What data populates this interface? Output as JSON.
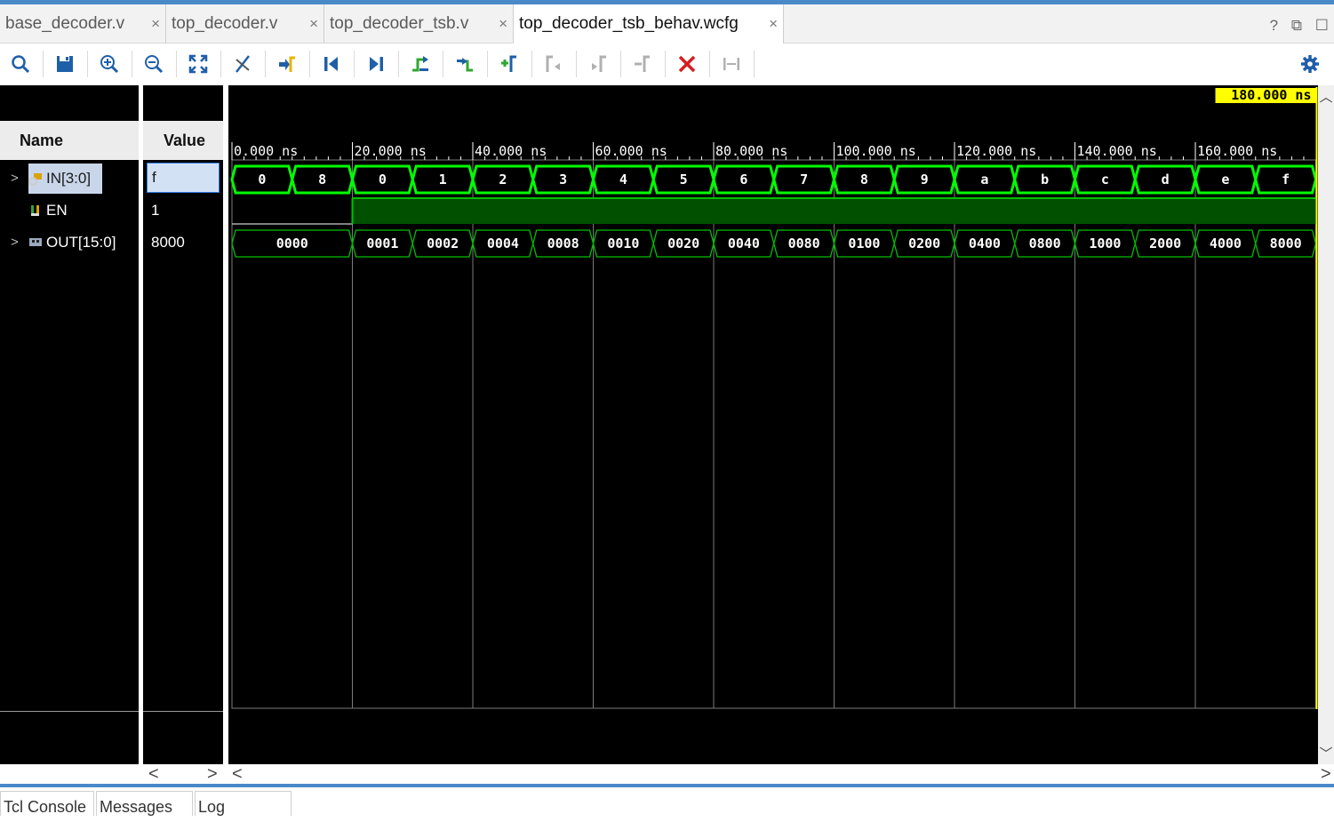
{
  "tabs": [
    {
      "label": "base_decoder.v",
      "close": "×",
      "active": false
    },
    {
      "label": "top_decoder.v",
      "close": "×",
      "active": false
    },
    {
      "label": "top_decoder_tsb.v",
      "close": "×",
      "active": false
    },
    {
      "label": "top_decoder_tsb_behav.wcfg",
      "close": "×",
      "active": true
    }
  ],
  "window_controls": {
    "help": "?",
    "restore": "⧉",
    "maximize": "☐"
  },
  "toolbar": {
    "icons": [
      "search-icon",
      "save-icon",
      "zoom-in-icon",
      "zoom-out-icon",
      "zoom-fit-icon",
      "cursor-snap-icon",
      "go-to-time-zero-icon",
      "go-to-start-icon",
      "go-to-end-icon",
      "previous-transition-icon",
      "next-transition-icon",
      "add-marker-icon",
      "previous-marker-icon",
      "next-marker-icon",
      "remove-marker-icon",
      "delete-icon",
      "marker-range-icon",
      "settings-gear-icon"
    ],
    "accent_green": "#2fa82f",
    "accent_yellow": "#e8b400",
    "accent_red": "#d61f1f"
  },
  "columns": {
    "name": "Name",
    "value": "Value"
  },
  "signals": [
    {
      "name": "IN[3:0]",
      "value": "f",
      "expandable": true,
      "selected": true,
      "icon": "bus-input-icon"
    },
    {
      "name": "EN",
      "value": "1",
      "expandable": false,
      "selected": false,
      "icon": "bit-input-icon"
    },
    {
      "name": "OUT[15:0]",
      "value": "8000",
      "expandable": true,
      "selected": false,
      "icon": "bus-output-icon"
    }
  ],
  "cursor": {
    "label": "180.000 ns",
    "time_ns": 180
  },
  "timeline": {
    "ticks": [
      "0.000 ns",
      "20.000 ns",
      "40.000 ns",
      "60.000 ns",
      "80.000 ns",
      "100.000 ns",
      "120.000 ns",
      "140.000 ns",
      "160.000 ns"
    ],
    "range_ns": [
      0,
      180
    ],
    "step_ns": 20
  },
  "waves": {
    "in": {
      "segments": [
        {
          "t0": 0,
          "t1": 10,
          "v": "0"
        },
        {
          "t0": 10,
          "t1": 20,
          "v": "8"
        },
        {
          "t0": 20,
          "t1": 30,
          "v": "0"
        },
        {
          "t0": 30,
          "t1": 40,
          "v": "1"
        },
        {
          "t0": 40,
          "t1": 50,
          "v": "2"
        },
        {
          "t0": 50,
          "t1": 60,
          "v": "3"
        },
        {
          "t0": 60,
          "t1": 70,
          "v": "4"
        },
        {
          "t0": 70,
          "t1": 80,
          "v": "5"
        },
        {
          "t0": 80,
          "t1": 90,
          "v": "6"
        },
        {
          "t0": 90,
          "t1": 100,
          "v": "7"
        },
        {
          "t0": 100,
          "t1": 110,
          "v": "8"
        },
        {
          "t0": 110,
          "t1": 120,
          "v": "9"
        },
        {
          "t0": 120,
          "t1": 130,
          "v": "a"
        },
        {
          "t0": 130,
          "t1": 140,
          "v": "b"
        },
        {
          "t0": 140,
          "t1": 150,
          "v": "c"
        },
        {
          "t0": 150,
          "t1": 160,
          "v": "d"
        },
        {
          "t0": 160,
          "t1": 170,
          "v": "e"
        },
        {
          "t0": 170,
          "t1": 180,
          "v": "f"
        }
      ]
    },
    "en": {
      "high_from_ns": 20,
      "high_to_ns": 180
    },
    "out": {
      "segments": [
        {
          "t0": 0,
          "t1": 20,
          "v": "0000"
        },
        {
          "t0": 20,
          "t1": 30,
          "v": "0001"
        },
        {
          "t0": 30,
          "t1": 40,
          "v": "0002"
        },
        {
          "t0": 40,
          "t1": 50,
          "v": "0004"
        },
        {
          "t0": 50,
          "t1": 60,
          "v": "0008"
        },
        {
          "t0": 60,
          "t1": 70,
          "v": "0010"
        },
        {
          "t0": 70,
          "t1": 80,
          "v": "0020"
        },
        {
          "t0": 80,
          "t1": 90,
          "v": "0040"
        },
        {
          "t0": 90,
          "t1": 100,
          "v": "0080"
        },
        {
          "t0": 100,
          "t1": 110,
          "v": "0100"
        },
        {
          "t0": 110,
          "t1": 120,
          "v": "0200"
        },
        {
          "t0": 120,
          "t1": 130,
          "v": "0400"
        },
        {
          "t0": 130,
          "t1": 140,
          "v": "0800"
        },
        {
          "t0": 140,
          "t1": 150,
          "v": "1000"
        },
        {
          "t0": 150,
          "t1": 160,
          "v": "2000"
        },
        {
          "t0": 160,
          "t1": 170,
          "v": "4000"
        },
        {
          "t0": 170,
          "t1": 180,
          "v": "8000"
        }
      ]
    },
    "colors": {
      "bus_selected": "#00ff00",
      "bus": "#00c000",
      "en_fill": "#005000",
      "grid": "#7a7a7a",
      "cursor": "#ffff00",
      "cursor_label_text": "#000000"
    }
  },
  "scroll": {
    "left": "<",
    "right": ">",
    "up": "︿",
    "down": "﹀"
  },
  "bottom_tabs": [
    "Tcl Console",
    "Messages",
    "Log"
  ]
}
